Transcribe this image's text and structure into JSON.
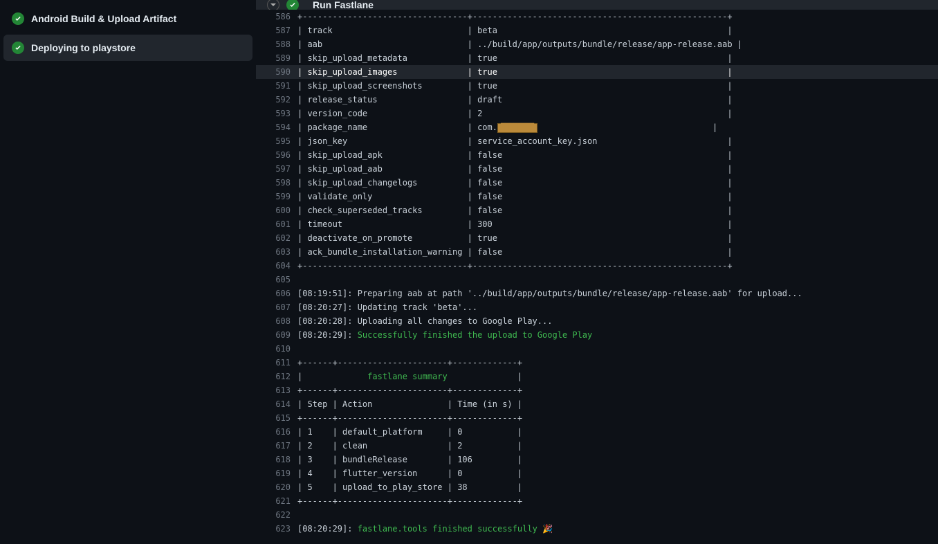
{
  "sidebar": {
    "items": [
      {
        "label": "Android Build & Upload Artifact",
        "active": false
      },
      {
        "label": "Deploying to playstore",
        "active": true
      }
    ]
  },
  "step": {
    "title": "Run Fastlane"
  },
  "log": {
    "lines": [
      {
        "n": 586,
        "text": "+---------------------------------+---------------------------------------------------+"
      },
      {
        "n": 587,
        "text": "| track                           | beta                                              |"
      },
      {
        "n": 588,
        "text": "| aab                             | ../build/app/outputs/bundle/release/app-release.aab |"
      },
      {
        "n": 589,
        "text": "| skip_upload_metadata            | true                                              |"
      },
      {
        "n": 590,
        "text": "| skip_upload_images              | true                                              |",
        "hl": true
      },
      {
        "n": 591,
        "text": "| skip_upload_screenshots         | true                                              |"
      },
      {
        "n": 592,
        "text": "| release_status                  | draft                                             |"
      },
      {
        "n": 593,
        "text": "| version_code                    | 2                                                 |"
      },
      {
        "n": 594,
        "special": "package_name"
      },
      {
        "n": 595,
        "text": "| json_key                        | service_account_key.json                          |"
      },
      {
        "n": 596,
        "text": "| skip_upload_apk                 | false                                             |"
      },
      {
        "n": 597,
        "text": "| skip_upload_aab                 | false                                             |"
      },
      {
        "n": 598,
        "text": "| skip_upload_changelogs          | false                                             |"
      },
      {
        "n": 599,
        "text": "| validate_only                   | false                                             |"
      },
      {
        "n": 600,
        "text": "| check_superseded_tracks         | false                                             |"
      },
      {
        "n": 601,
        "text": "| timeout                         | 300                                               |"
      },
      {
        "n": 602,
        "text": "| deactivate_on_promote           | true                                              |"
      },
      {
        "n": 603,
        "text": "| ack_bundle_installation_warning | false                                             |"
      },
      {
        "n": 604,
        "text": "+---------------------------------+---------------------------------------------------+"
      },
      {
        "n": 605,
        "text": ""
      },
      {
        "n": 606,
        "text": "[08:19:51]: Preparing aab at path '../build/app/outputs/bundle/release/app-release.aab' for upload..."
      },
      {
        "n": 607,
        "text": "[08:20:27]: Updating track 'beta'..."
      },
      {
        "n": 608,
        "text": "[08:20:28]: Uploading all changes to Google Play..."
      },
      {
        "n": 609,
        "special": "upload_success"
      },
      {
        "n": 610,
        "text": ""
      },
      {
        "n": 611,
        "text": "+------+----------------------+-------------+"
      },
      {
        "n": 612,
        "special": "summary_header"
      },
      {
        "n": 613,
        "text": "+------+----------------------+-------------+"
      },
      {
        "n": 614,
        "text": "| Step | Action               | Time (in s) |"
      },
      {
        "n": 615,
        "text": "+------+----------------------+-------------+"
      },
      {
        "n": 616,
        "text": "| 1    | default_platform     | 0           |"
      },
      {
        "n": 617,
        "text": "| 2    | clean                | 2           |"
      },
      {
        "n": 618,
        "text": "| 3    | bundleRelease        | 106         |"
      },
      {
        "n": 619,
        "text": "| 4    | flutter_version      | 0           |"
      },
      {
        "n": 620,
        "text": "| 5    | upload_to_play_store | 38          |"
      },
      {
        "n": 621,
        "text": "+------+----------------------+-------------+"
      },
      {
        "n": 622,
        "text": ""
      },
      {
        "n": 623,
        "special": "fastlane_success"
      }
    ],
    "specials": {
      "package_name": {
        "prefix": "| package_name                    | com.",
        "redacted": "████████",
        "suffix": "                                   |"
      },
      "upload_success": {
        "ts": "[08:20:29]: ",
        "msg": "Successfully finished the upload to Google Play"
      },
      "summary_header": {
        "prefix": "|             ",
        "title": "fastlane summary",
        "suffix": "              |"
      },
      "fastlane_success": {
        "ts": "[08:20:29]: ",
        "msg": "fastlane.tools finished successfully",
        "emoji": " 🎉"
      }
    }
  }
}
